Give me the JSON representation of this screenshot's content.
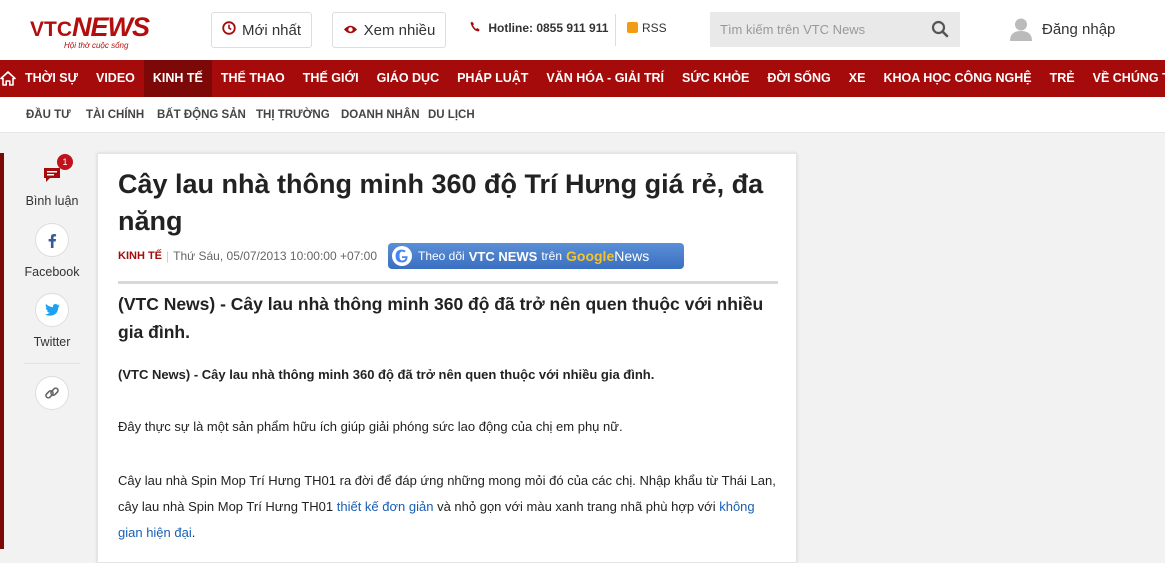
{
  "header": {
    "logo_main": "VTC",
    "logo_news": "NEWS",
    "logo_tagline": "Hội thờ cuộc sống",
    "latest_label": "Mới nhất",
    "popular_label": "Xem nhiều",
    "hotline": "Hotline: 0855 911 911",
    "rss_label": "RSS",
    "search_placeholder": "Tìm kiếm trên VTC News",
    "login_label": "Đăng nhập"
  },
  "nav": {
    "items": [
      "THỜI SỰ",
      "VIDEO",
      "KINH TẾ",
      "THỂ THAO",
      "THẾ GIỚI",
      "GIÁO DỤC",
      "PHÁP LUẬT",
      "VĂN HÓA - GIẢI TRÍ",
      "SỨC KHỎE",
      "ĐỜI SỐNG",
      "XE",
      "KHOA HỌC CÔNG NGHỆ",
      "TRẺ",
      "VỀ CHÚNG TÔI"
    ],
    "active_index": 2,
    "more_label": "•••"
  },
  "subnav": {
    "items": [
      "ĐẦU TƯ",
      "TÀI CHÍNH",
      "BẤT ĐỘNG SẢN",
      "THỊ TRƯỜNG",
      "DOANH NHÂN",
      "DU LỊCH"
    ]
  },
  "rail": {
    "comment_label": "Bình luận",
    "comment_count": "1",
    "facebook_label": "Facebook",
    "twitter_label": "Twitter"
  },
  "article": {
    "title": "Cây lau nhà thông minh 360 độ Trí Hưng giá rẻ, đa năng",
    "category": "KINH TẾ",
    "date": "Thứ Sáu, 05/07/2013 10:00:00 +07:00",
    "gnews_pre": "Theo dõi",
    "gnews_brand": "VTC NEWS",
    "gnews_mid": "trên",
    "gnews_google": "Google",
    "gnews_news": "News",
    "lead": "(VTC News) - Cây lau nhà thông minh 360 độ đã trở nên quen thuộc với nhiều gia đình.",
    "p1_bold": "(VTC News)",
    "p1_rest": " - Cây lau nhà thông minh 360 độ đã trở nên quen thuộc với nhiều gia đình.",
    "p2": "Đây thực sự là một sản phẩm hữu ích giúp giải phóng sức lao động của chị em phụ nữ.",
    "p3_a": "Cây lau nhà Spin Mop Trí Hưng TH01 ra đời để đáp ứng những mong mỏi đó của các chị. Nhập khẩu từ Thái Lan, cây lau nhà Spin Mop Trí Hưng TH01 ",
    "p3_link1": "thiết kế đơn giản",
    "p3_b": " và nhỏ gọn với màu xanh trang nhã phù hợp với ",
    "p3_link2": "không gian hiện đại",
    "p3_c": "."
  },
  "colors": {
    "brand": "#a50b0b",
    "link": "#1a5fb4"
  }
}
